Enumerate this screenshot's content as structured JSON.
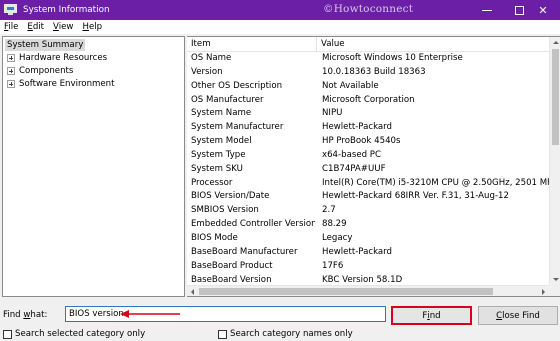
{
  "window": {
    "title": "System Information",
    "watermark": "©Howtoconnect",
    "close_symbol": "✕"
  },
  "menu": {
    "file": {
      "accel": "F",
      "rest": "ile"
    },
    "edit": {
      "accel": "E",
      "rest": "dit"
    },
    "view": {
      "accel": "V",
      "rest": "iew"
    },
    "help": {
      "accel": "H",
      "rest": "elp"
    }
  },
  "tree": {
    "root": "System Summary",
    "children": [
      "Hardware Resources",
      "Components",
      "Software Environment"
    ]
  },
  "list": {
    "columns": [
      "Item",
      "Value"
    ],
    "rows": [
      {
        "item": "OS Name",
        "value": "Microsoft Windows 10 Enterprise"
      },
      {
        "item": "Version",
        "value": "10.0.18363 Build 18363"
      },
      {
        "item": "Other OS Description",
        "value": "Not Available"
      },
      {
        "item": "OS Manufacturer",
        "value": "Microsoft Corporation"
      },
      {
        "item": "System Name",
        "value": "NIPU"
      },
      {
        "item": "System Manufacturer",
        "value": "Hewlett-Packard"
      },
      {
        "item": "System Model",
        "value": "HP ProBook 4540s"
      },
      {
        "item": "System Type",
        "value": "x64-based PC"
      },
      {
        "item": "System SKU",
        "value": "C1B74PA#UUF"
      },
      {
        "item": "Processor",
        "value": "Intel(R) Core(TM) i5-3210M CPU @ 2.50GHz, 2501 Mhz, 2 C"
      },
      {
        "item": "BIOS Version/Date",
        "value": "Hewlett-Packard 68IRR Ver. F.31, 31-Aug-12"
      },
      {
        "item": "SMBIOS Version",
        "value": "2.7"
      },
      {
        "item": "Embedded Controller Version",
        "value": "88.29"
      },
      {
        "item": "BIOS Mode",
        "value": "Legacy"
      },
      {
        "item": "BaseBoard Manufacturer",
        "value": "Hewlett-Packard"
      },
      {
        "item": "BaseBoard Product",
        "value": "17F6"
      },
      {
        "item": "BaseBoard Version",
        "value": "KBC Version 58.1D"
      }
    ]
  },
  "find": {
    "label_accel": "w",
    "label_pre": "Find ",
    "label_post": "hat:",
    "value": "BIOS version",
    "find_button": {
      "accel": "i",
      "pre": "F",
      "post": "nd"
    },
    "close_button": {
      "accel": "C",
      "pre": "",
      "post": "lose Find"
    },
    "check_selected": "Search selected category only",
    "check_names": "Search category names only"
  },
  "colors": {
    "titlebar": "#6b1fa6",
    "highlight_border": "#d8001c",
    "annotation_arrow": "#d8001c"
  }
}
